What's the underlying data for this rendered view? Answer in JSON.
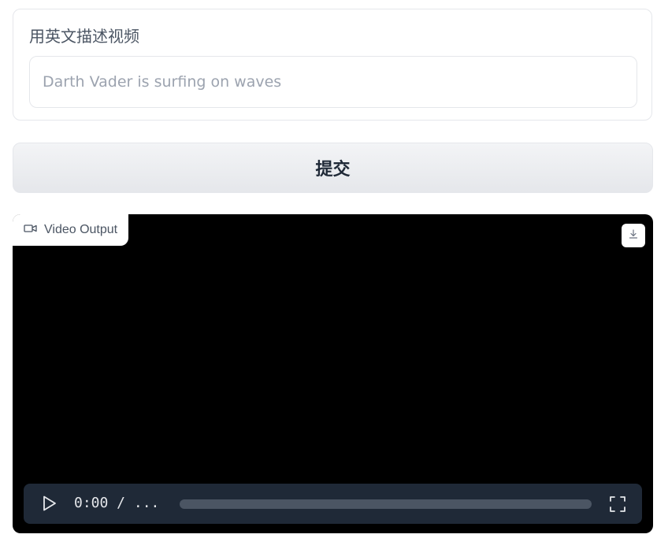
{
  "prompt": {
    "label": "用英文描述视频",
    "value": "",
    "placeholder": "Darth Vader is surfing on waves"
  },
  "submit": {
    "label": "提交"
  },
  "video_output": {
    "label": "Video Output",
    "icons": {
      "label_icon": "video-camera-icon",
      "download": "download-icon",
      "play": "play-icon",
      "fullscreen": "fullscreen-icon"
    },
    "controls": {
      "time": "0:00 / ...",
      "progress_fraction": 0
    }
  },
  "colors": {
    "video_background": "#000000",
    "controls_background": "#1f2937",
    "progress_track": "#4b5563"
  }
}
